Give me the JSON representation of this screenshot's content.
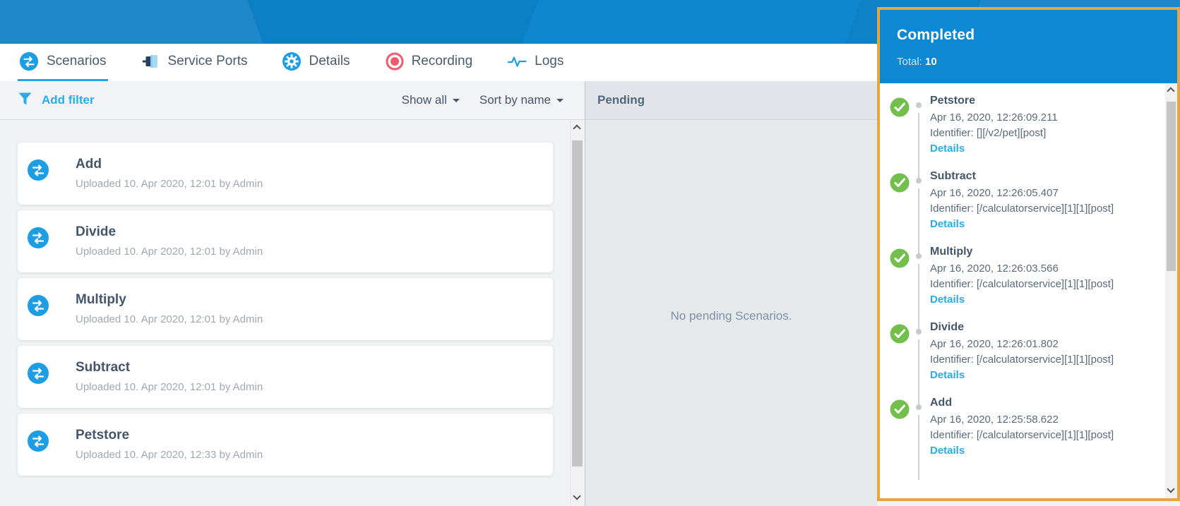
{
  "colors": {
    "banner_blue": "#0e86d0",
    "accent_blue": "#29a4e9",
    "link_blue": "#29abe8",
    "panel_header_blue": "#0d89d4",
    "panel_border_orange": "#eaa63e",
    "success_green": "#72bf4c",
    "record_red": "#f2596b"
  },
  "tabs": [
    {
      "label": "Scenarios",
      "icon": "swap-icon",
      "active": true
    },
    {
      "label": "Service Ports",
      "icon": "port-icon",
      "active": false
    },
    {
      "label": "Details",
      "icon": "gear-icon",
      "active": false
    },
    {
      "label": "Recording",
      "icon": "record-icon",
      "active": false
    },
    {
      "label": "Logs",
      "icon": "waveform-icon",
      "active": false
    }
  ],
  "filter_bar": {
    "add_filter_label": "Add filter",
    "show_all_label": "Show all",
    "sort_label": "Sort by name"
  },
  "scenarios": {
    "items": [
      {
        "title": "Add",
        "subtitle": "Uploaded 10. Apr 2020, 12:01 by Admin"
      },
      {
        "title": "Divide",
        "subtitle": "Uploaded 10. Apr 2020, 12:01 by Admin"
      },
      {
        "title": "Multiply",
        "subtitle": "Uploaded 10. Apr 2020, 12:01 by Admin"
      },
      {
        "title": "Subtract",
        "subtitle": "Uploaded 10. Apr 2020, 12:01 by Admin"
      },
      {
        "title": "Petstore",
        "subtitle": "Uploaded 10. Apr 2020, 12:33 by Admin"
      }
    ]
  },
  "pending": {
    "title": "Pending",
    "empty_message": "No pending Scenarios."
  },
  "completed": {
    "title": "Completed",
    "total_label": "Total:",
    "total_value": "10",
    "items": [
      {
        "title": "Petstore",
        "timestamp": "Apr 16, 2020, 12:26:09.211",
        "identifier": "Identifier: [][/v2/pet][post]",
        "details_label": "Details"
      },
      {
        "title": "Subtract",
        "timestamp": "Apr 16, 2020, 12:26:05.407",
        "identifier": "Identifier: [/calculatorservice][1][1][post]",
        "details_label": "Details"
      },
      {
        "title": "Multiply",
        "timestamp": "Apr 16, 2020, 12:26:03.566",
        "identifier": "Identifier: [/calculatorservice][1][1][post]",
        "details_label": "Details"
      },
      {
        "title": "Divide",
        "timestamp": "Apr 16, 2020, 12:26:01.802",
        "identifier": "Identifier: [/calculatorservice][1][1][post]",
        "details_label": "Details"
      },
      {
        "title": "Add",
        "timestamp": "Apr 16, 2020, 12:25:58.622",
        "identifier": "Identifier: [/calculatorservice][1][1][post]",
        "details_label": "Details"
      }
    ]
  }
}
